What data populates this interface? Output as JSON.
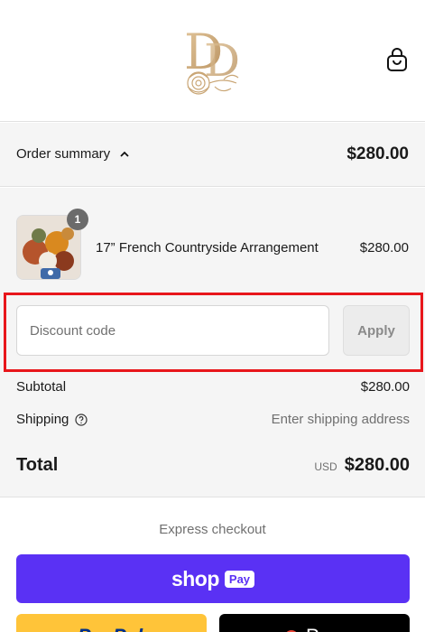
{
  "header": {
    "logo_text": "DD",
    "cart_icon": "shopping-bag-icon"
  },
  "order_summary": {
    "label": "Order summary",
    "toggle_icon": "chevron-up-icon",
    "total": "$280.00"
  },
  "line_items": [
    {
      "quantity": "1",
      "name": "17” French Countryside Arrangement",
      "price": "$280.00"
    }
  ],
  "discount": {
    "placeholder": "Discount code",
    "value": "",
    "apply_label": "Apply"
  },
  "totals": {
    "subtotal_label": "Subtotal",
    "subtotal_value": "$280.00",
    "shipping_label": "Shipping",
    "shipping_help_icon": "question-circle-icon",
    "shipping_value": "Enter shipping address",
    "total_label": "Total",
    "currency": "USD",
    "total_value": "$280.00"
  },
  "express_checkout": {
    "label": "Express checkout",
    "shop_word": "shop",
    "pay_badge": "Pay",
    "paypal_label": "PayPal",
    "gpay_label": "Pay"
  },
  "colors": {
    "shop_pay": "#5a31f4",
    "paypal": "#ffc439",
    "highlight": "#e8161b",
    "logo_gold": "#c9a574"
  }
}
